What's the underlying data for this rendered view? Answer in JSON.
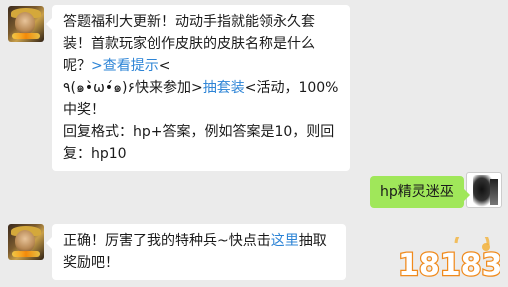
{
  "msg1": {
    "t1": "答题福利大更新！动动手指就能领永久套装！首款玩家创作皮肤的皮肤名称是什么呢？",
    "link1": ">查看提示",
    "t2": "<",
    "t3": "٩(๑•̀ω•́๑)۶快来参加>",
    "link2": "抽套装",
    "t4": "<活动，100%中奖！",
    "t5": "回复格式：hp+答案，例如答案是10，则回复：hp10"
  },
  "msg2": {
    "text": "hp精灵迷巫"
  },
  "msg3": {
    "t1": "正确！厉害了我的特种兵~快点击",
    "link": "这里",
    "t2": "抽取奖励吧！"
  },
  "watermark": {
    "text": "18183"
  },
  "colors": {
    "link": "#2d84d6",
    "bubble_right": "#a0e75a",
    "bg": "#ebebeb"
  }
}
